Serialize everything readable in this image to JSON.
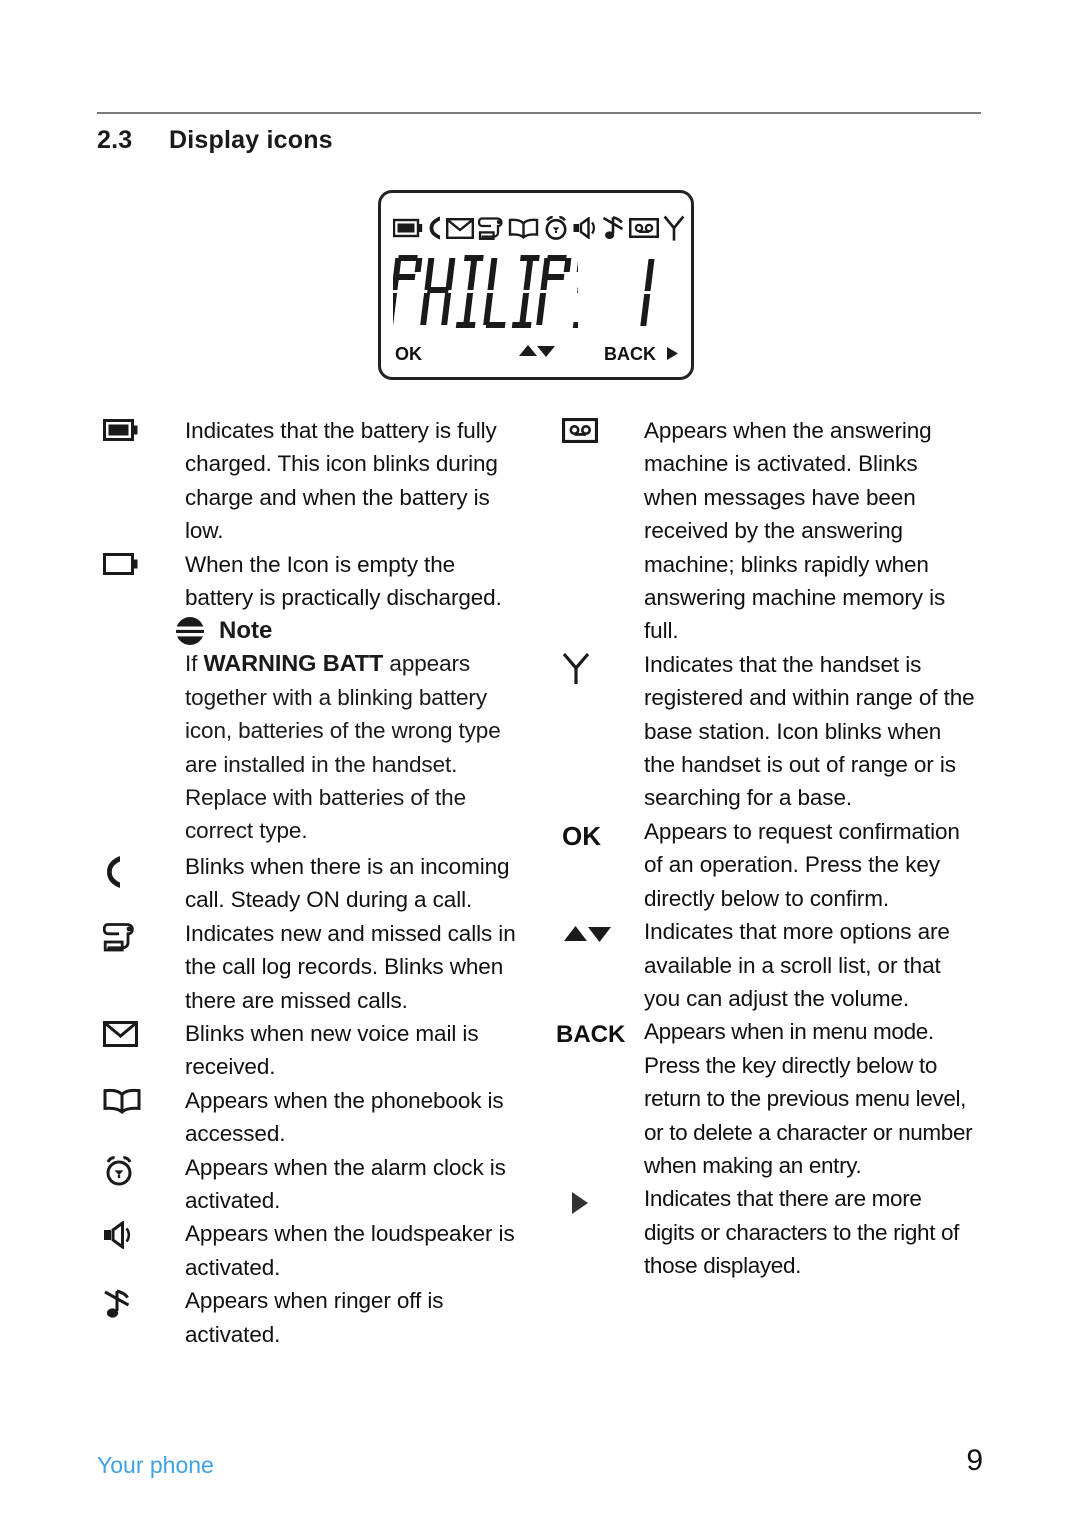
{
  "section": {
    "number": "2.3",
    "title": "Display icons"
  },
  "lcd": {
    "icon_row": [
      "battery-full-icon",
      "call-handset-icon",
      "envelope-icon",
      "call-log-scroll-icon",
      "phonebook-icon",
      "alarm-clock-icon",
      "loudspeaker-icon",
      "ringer-off-note-icon",
      "answering-machine-icon",
      "antenna-icon"
    ],
    "display_text": "PHILIPS",
    "display_number": "1",
    "softkey_left": "OK",
    "softkey_middle": "scroll-up-down-icon",
    "softkey_right": "BACK"
  },
  "left_column": [
    {
      "icon": "battery-full-icon",
      "text": "Indicates that the battery is fully charged. This icon blinks during charge and when the battery is low."
    },
    {
      "icon": "battery-empty-icon",
      "text": "When the Icon is empty the battery is practically discharged."
    },
    {
      "icon": "call-handset-icon",
      "text": "Blinks when there is an incoming call. Steady ON during a call."
    },
    {
      "icon": "call-log-scroll-icon",
      "text": "Indicates new and missed calls in the call log records. Blinks when there are missed calls."
    },
    {
      "icon": "envelope-icon",
      "text": "Blinks when new voice mail is received."
    },
    {
      "icon": "phonebook-icon",
      "text": "Appears when the phonebook is accessed."
    },
    {
      "icon": "alarm-clock-icon",
      "text": "Appears when the alarm clock is activated."
    },
    {
      "icon": "loudspeaker-icon",
      "text": "Appears when the loudspeaker is activated."
    },
    {
      "icon": "ringer-off-note-icon",
      "text": "Appears when ringer off is activated."
    }
  ],
  "note": {
    "icon": "note-stripes-icon",
    "heading": "Note",
    "text_prefix": "If ",
    "text_strong": "WARNING BATT",
    "text_suffix": " appears together with a blinking battery icon, batteries of the wrong type are installed in the handset. Replace with batteries of the correct type."
  },
  "right_column": [
    {
      "icon": "answering-machine-icon",
      "text": "Appears when the answering machine is activated. Blinks when messages have been received by the answering machine; blinks rapidly when answering machine memory is full."
    },
    {
      "icon": "antenna-icon",
      "text": "Indicates that the handset is registered and within range of the base station. Icon blinks when the handset is out of range or is searching for a base."
    },
    {
      "icon": "ok-softkey-label",
      "label": "OK",
      "text": "Appears to request confirmation of an operation. Press the key directly below to confirm."
    },
    {
      "icon": "scroll-up-down-icon",
      "text": "Indicates that more options are available in a scroll list, or that you can adjust the volume."
    },
    {
      "icon": "back-softkey-label",
      "label": "BACK",
      "text": "Appears when in menu mode. Press the key directly below to return to the previous menu level, or to delete a character or number when making an entry."
    },
    {
      "icon": "right-arrow-icon",
      "text": "Indicates that there are more digits or characters to the right of those displayed."
    }
  ],
  "footer": {
    "chapter": "Your phone",
    "page_number": "9",
    "accent_color": "#3fa2e0"
  }
}
